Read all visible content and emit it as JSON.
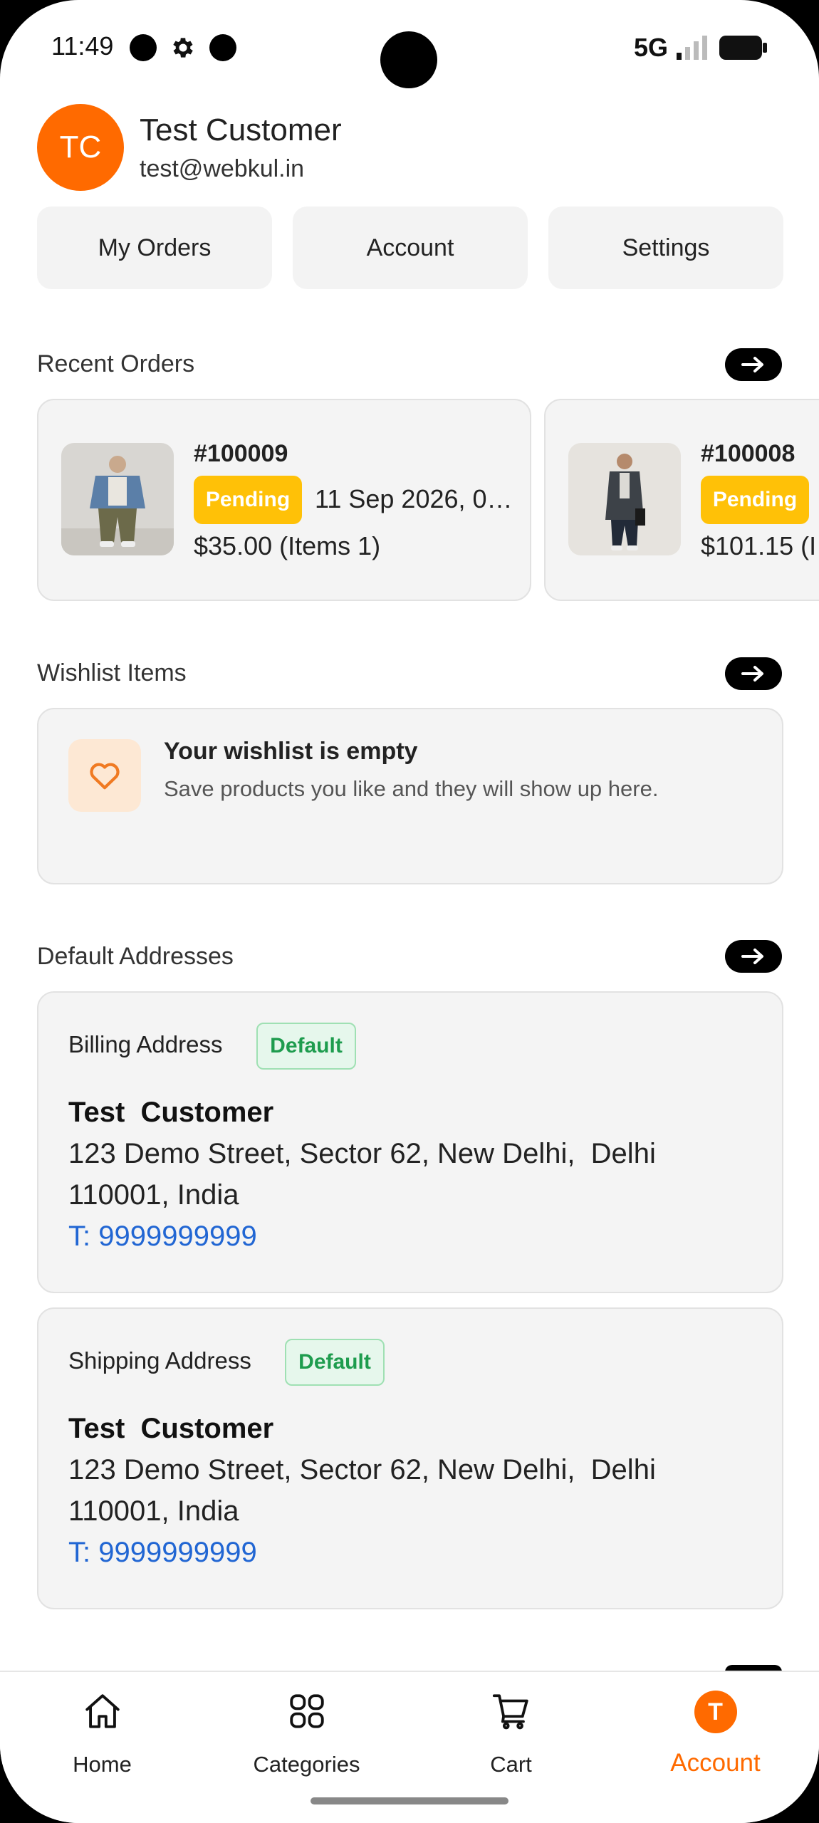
{
  "status_bar": {
    "time": "11:49",
    "network": "5G"
  },
  "profile": {
    "initials": "TC",
    "name": "Test Customer",
    "email": "test@webkul.in"
  },
  "quick_actions": [
    "My Orders",
    "Account",
    "Settings"
  ],
  "recent_orders": {
    "title": "Recent Orders",
    "orders": [
      {
        "number": "#100009",
        "status": "Pending",
        "date": "11 Sep 2026, 0…",
        "total": "$35.00 (Items 1)"
      },
      {
        "number": "#100008",
        "status": "Pending",
        "total": "$101.15 (I"
      }
    ]
  },
  "wishlist": {
    "title": "Wishlist Items",
    "empty_title": "Your wishlist is empty",
    "empty_subtitle": "Save products you like and they will show up here."
  },
  "addresses": {
    "title": "Default Addresses",
    "billing": {
      "label": "Billing Address",
      "badge": "Default",
      "name": "Test  Customer",
      "line1": "123 Demo Street, Sector 62, New Delhi,  Delhi",
      "line2": "110001, India",
      "phone": "T: 9999999999"
    },
    "shipping": {
      "label": "Shipping Address",
      "badge": "Default",
      "name": "Test  Customer",
      "line1": "123 Demo Street, Sector 62, New Delhi,  Delhi",
      "line2": "110001, India",
      "phone": "T: 9999999999"
    }
  },
  "bottom_nav": {
    "home": "Home",
    "categories": "Categories",
    "cart": "Cart",
    "account": "Account",
    "account_initial": "T",
    "active_color": "#ff6a00"
  }
}
